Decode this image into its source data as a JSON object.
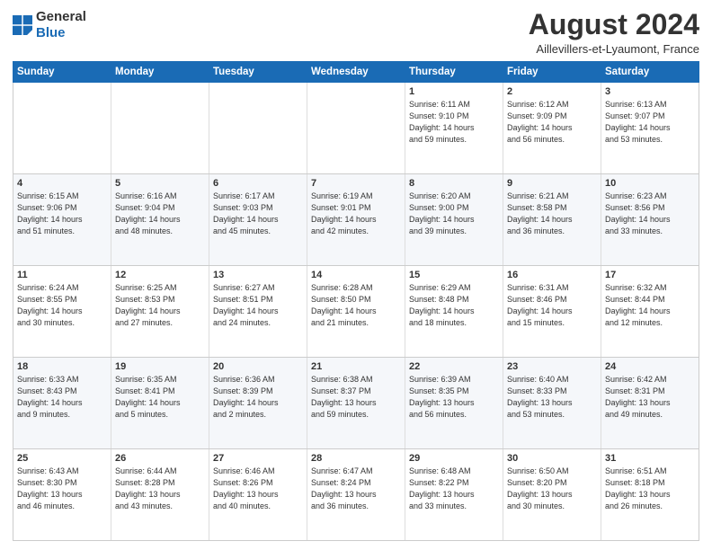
{
  "logo": {
    "general": "General",
    "blue": "Blue"
  },
  "header": {
    "month_year": "August 2024",
    "location": "Aillevillers-et-Lyaumont, France"
  },
  "days_of_week": [
    "Sunday",
    "Monday",
    "Tuesday",
    "Wednesday",
    "Thursday",
    "Friday",
    "Saturday"
  ],
  "weeks": [
    [
      {
        "day": "",
        "info": ""
      },
      {
        "day": "",
        "info": ""
      },
      {
        "day": "",
        "info": ""
      },
      {
        "day": "",
        "info": ""
      },
      {
        "day": "1",
        "info": "Sunrise: 6:11 AM\nSunset: 9:10 PM\nDaylight: 14 hours\nand 59 minutes."
      },
      {
        "day": "2",
        "info": "Sunrise: 6:12 AM\nSunset: 9:09 PM\nDaylight: 14 hours\nand 56 minutes."
      },
      {
        "day": "3",
        "info": "Sunrise: 6:13 AM\nSunset: 9:07 PM\nDaylight: 14 hours\nand 53 minutes."
      }
    ],
    [
      {
        "day": "4",
        "info": "Sunrise: 6:15 AM\nSunset: 9:06 PM\nDaylight: 14 hours\nand 51 minutes."
      },
      {
        "day": "5",
        "info": "Sunrise: 6:16 AM\nSunset: 9:04 PM\nDaylight: 14 hours\nand 48 minutes."
      },
      {
        "day": "6",
        "info": "Sunrise: 6:17 AM\nSunset: 9:03 PM\nDaylight: 14 hours\nand 45 minutes."
      },
      {
        "day": "7",
        "info": "Sunrise: 6:19 AM\nSunset: 9:01 PM\nDaylight: 14 hours\nand 42 minutes."
      },
      {
        "day": "8",
        "info": "Sunrise: 6:20 AM\nSunset: 9:00 PM\nDaylight: 14 hours\nand 39 minutes."
      },
      {
        "day": "9",
        "info": "Sunrise: 6:21 AM\nSunset: 8:58 PM\nDaylight: 14 hours\nand 36 minutes."
      },
      {
        "day": "10",
        "info": "Sunrise: 6:23 AM\nSunset: 8:56 PM\nDaylight: 14 hours\nand 33 minutes."
      }
    ],
    [
      {
        "day": "11",
        "info": "Sunrise: 6:24 AM\nSunset: 8:55 PM\nDaylight: 14 hours\nand 30 minutes."
      },
      {
        "day": "12",
        "info": "Sunrise: 6:25 AM\nSunset: 8:53 PM\nDaylight: 14 hours\nand 27 minutes."
      },
      {
        "day": "13",
        "info": "Sunrise: 6:27 AM\nSunset: 8:51 PM\nDaylight: 14 hours\nand 24 minutes."
      },
      {
        "day": "14",
        "info": "Sunrise: 6:28 AM\nSunset: 8:50 PM\nDaylight: 14 hours\nand 21 minutes."
      },
      {
        "day": "15",
        "info": "Sunrise: 6:29 AM\nSunset: 8:48 PM\nDaylight: 14 hours\nand 18 minutes."
      },
      {
        "day": "16",
        "info": "Sunrise: 6:31 AM\nSunset: 8:46 PM\nDaylight: 14 hours\nand 15 minutes."
      },
      {
        "day": "17",
        "info": "Sunrise: 6:32 AM\nSunset: 8:44 PM\nDaylight: 14 hours\nand 12 minutes."
      }
    ],
    [
      {
        "day": "18",
        "info": "Sunrise: 6:33 AM\nSunset: 8:43 PM\nDaylight: 14 hours\nand 9 minutes."
      },
      {
        "day": "19",
        "info": "Sunrise: 6:35 AM\nSunset: 8:41 PM\nDaylight: 14 hours\nand 5 minutes."
      },
      {
        "day": "20",
        "info": "Sunrise: 6:36 AM\nSunset: 8:39 PM\nDaylight: 14 hours\nand 2 minutes."
      },
      {
        "day": "21",
        "info": "Sunrise: 6:38 AM\nSunset: 8:37 PM\nDaylight: 13 hours\nand 59 minutes."
      },
      {
        "day": "22",
        "info": "Sunrise: 6:39 AM\nSunset: 8:35 PM\nDaylight: 13 hours\nand 56 minutes."
      },
      {
        "day": "23",
        "info": "Sunrise: 6:40 AM\nSunset: 8:33 PM\nDaylight: 13 hours\nand 53 minutes."
      },
      {
        "day": "24",
        "info": "Sunrise: 6:42 AM\nSunset: 8:31 PM\nDaylight: 13 hours\nand 49 minutes."
      }
    ],
    [
      {
        "day": "25",
        "info": "Sunrise: 6:43 AM\nSunset: 8:30 PM\nDaylight: 13 hours\nand 46 minutes."
      },
      {
        "day": "26",
        "info": "Sunrise: 6:44 AM\nSunset: 8:28 PM\nDaylight: 13 hours\nand 43 minutes."
      },
      {
        "day": "27",
        "info": "Sunrise: 6:46 AM\nSunset: 8:26 PM\nDaylight: 13 hours\nand 40 minutes."
      },
      {
        "day": "28",
        "info": "Sunrise: 6:47 AM\nSunset: 8:24 PM\nDaylight: 13 hours\nand 36 minutes."
      },
      {
        "day": "29",
        "info": "Sunrise: 6:48 AM\nSunset: 8:22 PM\nDaylight: 13 hours\nand 33 minutes."
      },
      {
        "day": "30",
        "info": "Sunrise: 6:50 AM\nSunset: 8:20 PM\nDaylight: 13 hours\nand 30 minutes."
      },
      {
        "day": "31",
        "info": "Sunrise: 6:51 AM\nSunset: 8:18 PM\nDaylight: 13 hours\nand 26 minutes."
      }
    ]
  ]
}
